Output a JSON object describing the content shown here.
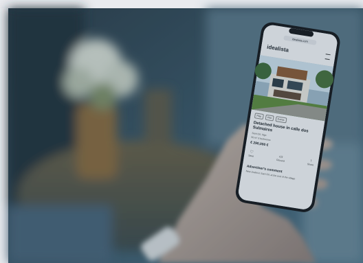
{
  "browser": {
    "url": "idealista.com"
  },
  "app": {
    "logo": "idealista"
  },
  "listing": {
    "tags": [
      "Play",
      "Flat",
      "Extras"
    ],
    "title": "Detached house in calle dos Sulmaires",
    "subtitle": "Sant Gil, Vigo",
    "details": "90 m²  3 bedrooms",
    "price": "€ 290,000 €",
    "actions": [
      "Save",
      "Discard",
      "Share"
    ],
    "advertiser_heading": "Advertiser's comment",
    "advertiser_text": "New chalet in Sant Gil, at the end of the village"
  },
  "colors": {
    "overlay": "#1a3f54",
    "brand": "#c8e04a",
    "screen_bg": "#f4f5f7"
  }
}
